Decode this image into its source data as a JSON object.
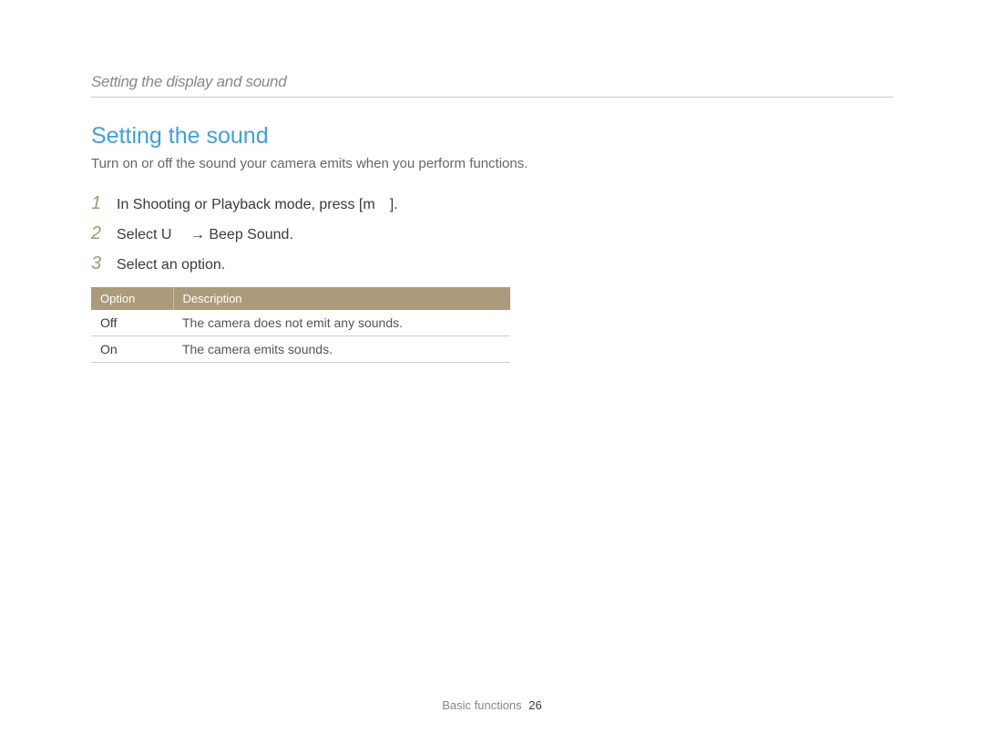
{
  "breadcrumb": "Setting the display and sound",
  "section_title": "Setting the sound",
  "intro": "Turn on or off the sound your camera emits when you perform functions.",
  "steps": [
    {
      "num": "1",
      "text": "In Shooting or Playback mode, press [m ]."
    },
    {
      "num": "2",
      "text": "Select U  → Beep Sound."
    },
    {
      "num": "3",
      "text": "Select an option."
    }
  ],
  "table": {
    "headers": {
      "option": "Option",
      "description": "Description"
    },
    "rows": [
      {
        "option": "Off",
        "description": "The camera does not emit any sounds."
      },
      {
        "option": "On",
        "description": "The camera emits sounds."
      }
    ]
  },
  "footer": {
    "section": "Basic functions",
    "page": "26"
  }
}
